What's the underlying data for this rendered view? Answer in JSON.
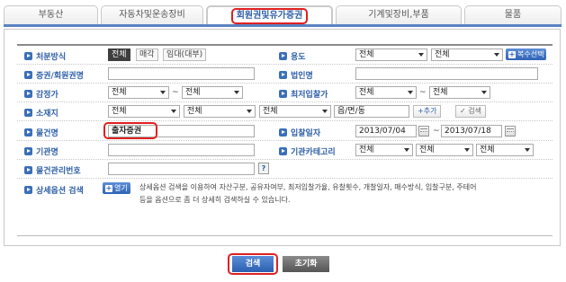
{
  "tabs": [
    "부동산",
    "자동차및운송장비",
    "회원권및유가증권",
    "기계및장비,부품",
    "물품"
  ],
  "active_tab": 2,
  "form": {
    "disposal_method": {
      "label": "처분방식",
      "options": [
        "전체",
        "매각",
        "임대(대부)"
      ],
      "selected": "전체"
    },
    "usage": {
      "label": "용도",
      "select1": "전체",
      "select2": "전체",
      "multi_button": "복수선택"
    },
    "securities_name": {
      "label": "증권/회원권명",
      "value": ""
    },
    "corp_name": {
      "label": "법인명",
      "value": ""
    },
    "appraisal": {
      "label": "감정가",
      "from": "전체",
      "to": "전체",
      "sep": "~"
    },
    "min_bid": {
      "label": "최저입찰가",
      "from": "전체",
      "to": "전체",
      "sep": "~"
    },
    "location": {
      "label": "소재지",
      "sel1": "전체",
      "sel2": "전체",
      "sel3": "전체",
      "dong_label": "읍/면/동",
      "add_button": "추가",
      "search_button": "검색"
    },
    "item_name": {
      "label": "물건명",
      "value": "출자증권"
    },
    "bid_date": {
      "label": "입찰일자",
      "from": "2013/07/04",
      "to": "2013/07/18",
      "sep": "~"
    },
    "org_name": {
      "label": "기관명",
      "value": ""
    },
    "org_category": {
      "label": "기관카테고리",
      "sel1": "전체",
      "sel2": "전체",
      "sel3": "전체"
    },
    "item_mgmt_no": {
      "label": "물건관리번호",
      "value": "",
      "help": "?"
    },
    "detail_option": {
      "label": "상세옵션 검색",
      "toggle": "열기",
      "desc_line1": "상세옵션 검색을 이용하여 자산구분, 공유자여부, 최저입찰가율, 유찰횟수, 개찰일자, 매수방식, 입찰구분, 주테어",
      "desc_line2": "등을 옵션으로 좀 더 상세히 검색하실 수 있습니다."
    }
  },
  "buttons": {
    "search": "검색",
    "reset": "초기화"
  }
}
